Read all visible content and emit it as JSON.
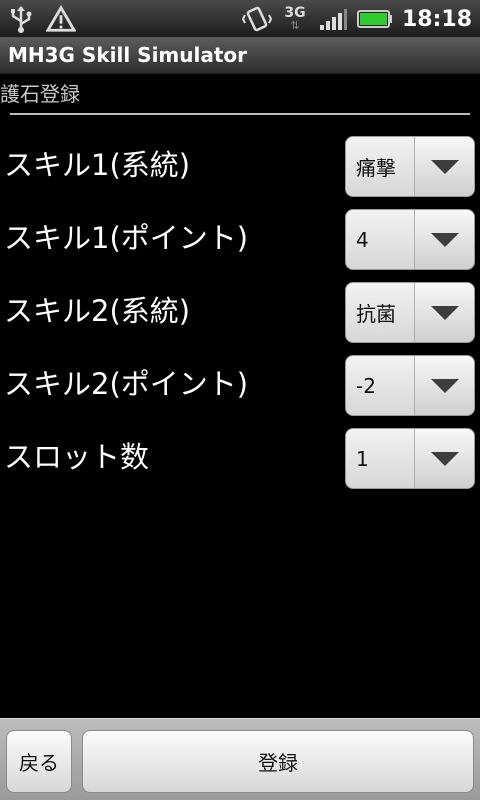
{
  "status_bar": {
    "time": "18:18",
    "network": "3G",
    "icons": [
      "usb-icon",
      "warning-icon",
      "vibrate-icon",
      "3g-icon",
      "signal-icon",
      "battery-icon"
    ]
  },
  "app": {
    "title": "MH3G Skill Simulator"
  },
  "section": {
    "label": "護石登録"
  },
  "rows": [
    {
      "label": "スキル1(系統)",
      "value": "痛撃"
    },
    {
      "label": "スキル1(ポイント)",
      "value": "4"
    },
    {
      "label": "スキル2(系統)",
      "value": "抗菌"
    },
    {
      "label": "スキル2(ポイント)",
      "value": "-2"
    },
    {
      "label": "スロット数",
      "value": "1"
    }
  ],
  "buttons": {
    "back": "戻る",
    "register": "登録"
  },
  "colors": {
    "background": "#000000",
    "battery": "#2ecc2e"
  }
}
